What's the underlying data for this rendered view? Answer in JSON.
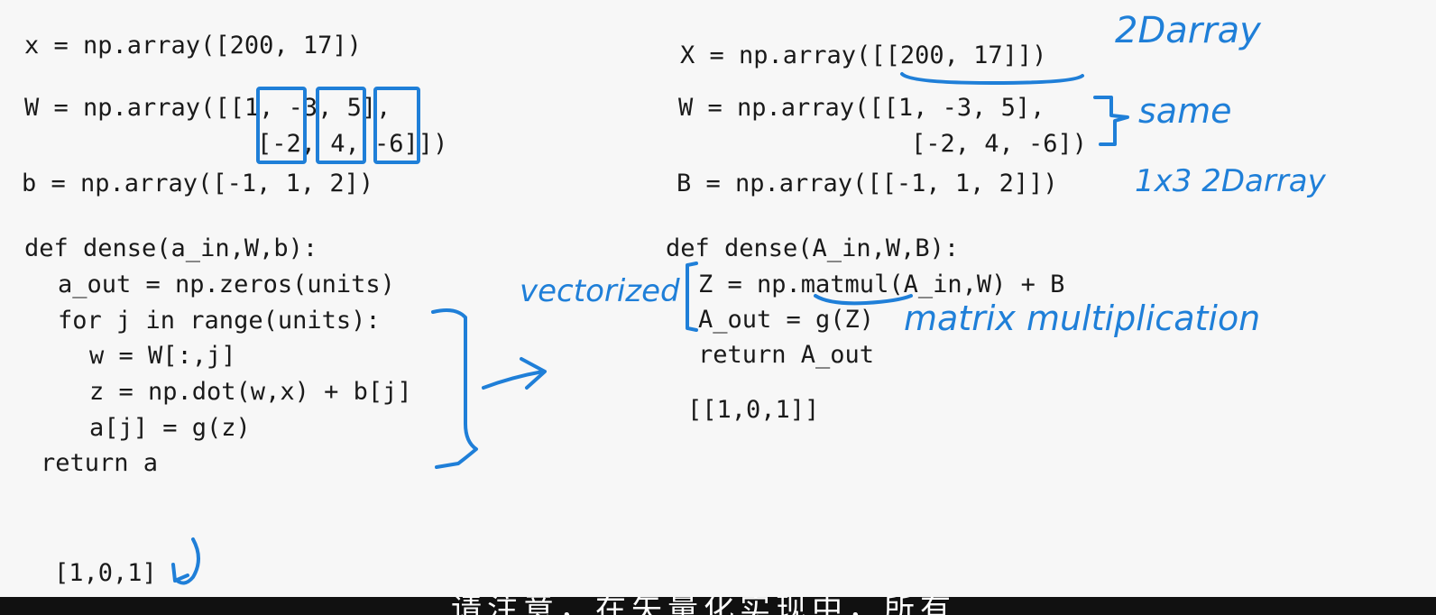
{
  "left_code": {
    "x_line": "x = np.array([200, 17])",
    "w_line1": "W = np.array([[1, -3, 5],",
    "w_line2": "[-2, 4, -6]])",
    "b_line": "b = np.array([-1, 1, 2])",
    "def_line": "def dense(a_in,W,b):",
    "aout_line": "a_out = np.zeros(units)",
    "for_line": "for j in range(units):",
    "w_col_line": "w = W[:,j]",
    "z_line": "z = np.dot(w,x) + b[j]",
    "a_line": "a[j] = g(z)",
    "return_line": "return a",
    "result": "[1,0,1]"
  },
  "right_code": {
    "x_line": "X = np.array([[200, 17]])",
    "w_line1": "W = np.array([[1, -3, 5],",
    "w_line2": "[-2, 4, -6])",
    "b_line": "B = np.array([[-1, 1, 2]])",
    "def_line": "def dense(A_in,W,B):",
    "z_line": "Z = np.matmul(A_in,W) + B",
    "aout_line": "A_out = g(Z)",
    "return_line": "return A_out",
    "result": "[[1,0,1]]"
  },
  "annotations": {
    "twod_array": "2Darray",
    "same": "same",
    "one_by_three": "1x3 2Darray",
    "vectorized": "vectorized",
    "matrix_multiplication": "matrix multiplication"
  },
  "subtitle": {
    "text": "请注意，在矢量化实现中，所有"
  },
  "colors": {
    "ink": "#1f7fd8",
    "code": "#1a1a1a",
    "background": "#f7f7f7"
  }
}
